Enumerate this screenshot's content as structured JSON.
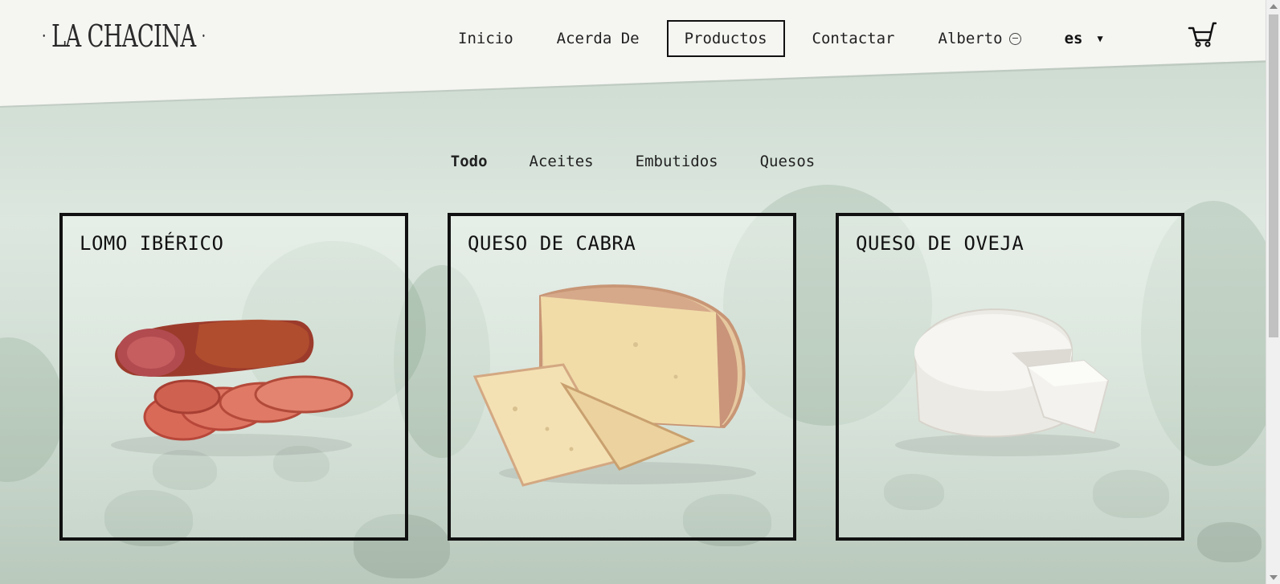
{
  "brand": {
    "logo_text": "LA CHACINA",
    "logo_dot": "·"
  },
  "nav": {
    "items": [
      {
        "label": "Inicio"
      },
      {
        "label": "Acerda De"
      },
      {
        "label": "Productos",
        "active": true
      },
      {
        "label": "Contactar"
      }
    ],
    "user": {
      "label": "Alberto",
      "icon": "logout-icon"
    },
    "language": {
      "value": "es",
      "icon": "caret-down-icon"
    },
    "cart": {
      "icon": "cart-icon"
    }
  },
  "filters": [
    {
      "label": "Todo",
      "active": true
    },
    {
      "label": "Aceites"
    },
    {
      "label": "Embutidos"
    },
    {
      "label": "Quesos"
    }
  ],
  "products": [
    {
      "title": "LOMO IBÉRICO",
      "image": "lomo-iberico"
    },
    {
      "title": "QUESO DE CABRA",
      "image": "queso-de-cabra"
    },
    {
      "title": "QUESO DE OVEJA",
      "image": "queso-de-oveja"
    }
  ],
  "colors": {
    "accent": "#111111",
    "background": "#cfddd1",
    "header": "#f5f5f2"
  }
}
